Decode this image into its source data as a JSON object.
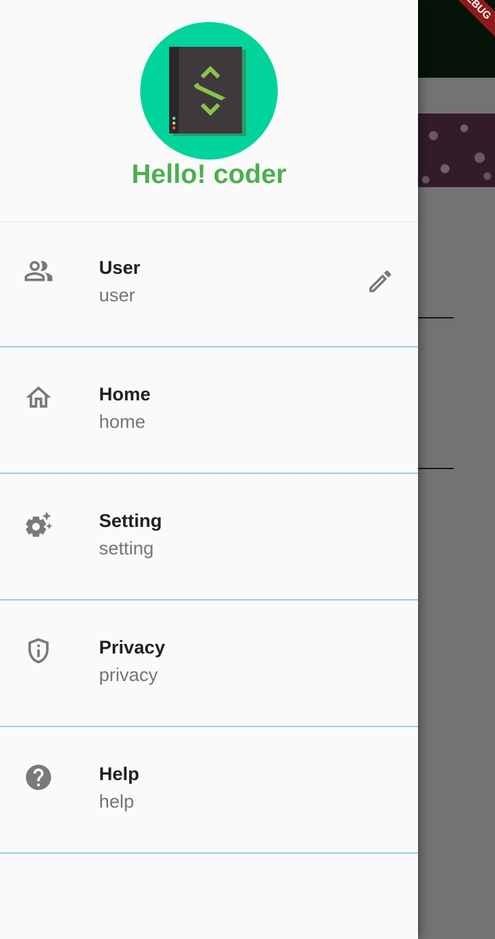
{
  "debug_banner": "DEBUG",
  "drawer": {
    "greeting": "Hello! coder",
    "items": [
      {
        "title": "User",
        "subtitle": "user",
        "icon": "people-outline-icon",
        "trailing_icon": "edit-pencil-icon"
      },
      {
        "title": "Home",
        "subtitle": "home",
        "icon": "home-outline-icon"
      },
      {
        "title": "Setting",
        "subtitle": "setting",
        "icon": "settings-suggest-icon"
      },
      {
        "title": "Privacy",
        "subtitle": "privacy",
        "icon": "shield-info-icon"
      },
      {
        "title": "Help",
        "subtitle": "help",
        "icon": "help-circle-icon"
      }
    ]
  },
  "colors": {
    "greeting": "#4caf50",
    "avatar_bg": "#00d49b",
    "divider": "#9dcfe0",
    "icon": "#7a7a7a"
  }
}
